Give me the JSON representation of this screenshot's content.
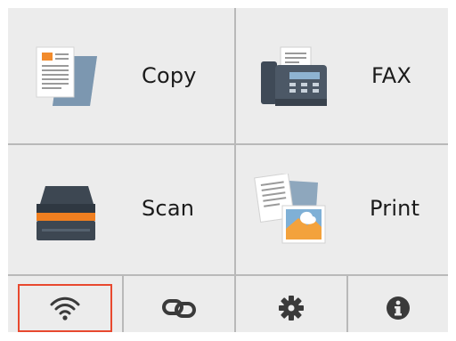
{
  "tiles": {
    "copy": {
      "label": "Copy"
    },
    "fax": {
      "label": "FAX"
    },
    "scan": {
      "label": "Scan"
    },
    "print": {
      "label": "Print"
    }
  },
  "bottom_bar": {
    "items": [
      {
        "icon": "wifi-icon",
        "selected": true
      },
      {
        "icon": "link-icon",
        "selected": false
      },
      {
        "icon": "gear-icon",
        "selected": false
      },
      {
        "icon": "info-icon",
        "selected": false
      }
    ]
  },
  "colors": {
    "panel_bg": "#ececec",
    "divider": "#b9b9b9",
    "selection_border": "#e8492f",
    "icon_dark": "#3a3a3a"
  }
}
